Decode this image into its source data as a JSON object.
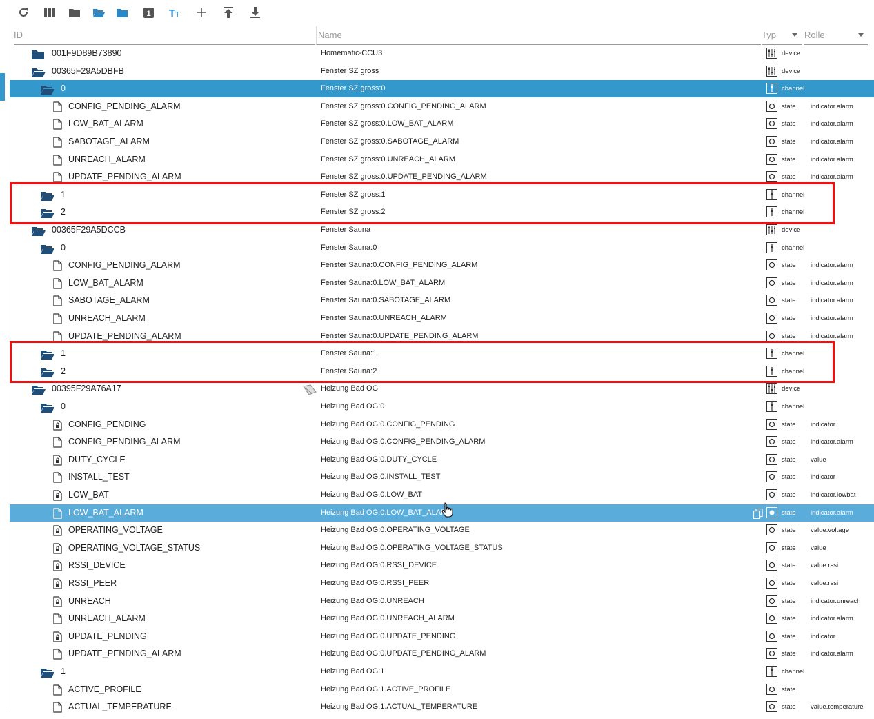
{
  "colors": {
    "accent": "#3399cc",
    "folder": "#1f4e78",
    "highlight_box": "#ee1111"
  },
  "toolbar": [
    {
      "icon": "refresh-icon"
    },
    {
      "icon": "columns-icon"
    },
    {
      "icon": "folder-closed-icon"
    },
    {
      "icon": "folder-open-icon"
    },
    {
      "icon": "folder-filled-icon"
    },
    {
      "icon": "counter-icon",
      "label": "1"
    },
    {
      "icon": "text-size-icon"
    },
    {
      "icon": "plus-icon"
    },
    {
      "icon": "upload-icon"
    },
    {
      "icon": "download-icon"
    }
  ],
  "header": {
    "id": "ID",
    "name": "Name",
    "typ": "Typ",
    "rolle": "Rolle"
  },
  "rows": [
    {
      "id": "001F9D89B73890",
      "name": "Homematic-CCU3",
      "type": "device",
      "role": "",
      "level": 0,
      "icon": "folder",
      "state": ""
    },
    {
      "id": "00365F29A5DBFB",
      "name": "Fenster SZ gross",
      "type": "device",
      "role": "",
      "level": 0,
      "icon": "folder-open",
      "state": ""
    },
    {
      "id": "0",
      "name": "Fenster SZ gross:0",
      "type": "channel",
      "role": "",
      "level": 1,
      "icon": "folder-open",
      "state": "sel"
    },
    {
      "id": "CONFIG_PENDING_ALARM",
      "name": "Fenster SZ gross:0.CONFIG_PENDING_ALARM",
      "type": "state",
      "role": "indicator.alarm",
      "level": 2,
      "icon": "file",
      "state": ""
    },
    {
      "id": "LOW_BAT_ALARM",
      "name": "Fenster SZ gross:0.LOW_BAT_ALARM",
      "type": "state",
      "role": "indicator.alarm",
      "level": 2,
      "icon": "file",
      "state": ""
    },
    {
      "id": "SABOTAGE_ALARM",
      "name": "Fenster SZ gross:0.SABOTAGE_ALARM",
      "type": "state",
      "role": "indicator.alarm",
      "level": 2,
      "icon": "file",
      "state": ""
    },
    {
      "id": "UNREACH_ALARM",
      "name": "Fenster SZ gross:0.UNREACH_ALARM",
      "type": "state",
      "role": "indicator.alarm",
      "level": 2,
      "icon": "file",
      "state": ""
    },
    {
      "id": "UPDATE_PENDING_ALARM",
      "name": "Fenster SZ gross:0.UPDATE_PENDING_ALARM",
      "type": "state",
      "role": "indicator.alarm",
      "level": 2,
      "icon": "file",
      "state": ""
    },
    {
      "id": "1",
      "name": "Fenster SZ gross:1",
      "type": "channel",
      "role": "",
      "level": 1,
      "icon": "folder-open",
      "state": ""
    },
    {
      "id": "2",
      "name": "Fenster SZ gross:2",
      "type": "channel",
      "role": "",
      "level": 1,
      "icon": "folder-open",
      "state": ""
    },
    {
      "id": "00365F29A5DCCB",
      "name": "Fenster Sauna",
      "type": "device",
      "role": "",
      "level": 0,
      "icon": "folder-open",
      "state": ""
    },
    {
      "id": "0",
      "name": "Fenster Sauna:0",
      "type": "channel",
      "role": "",
      "level": 1,
      "icon": "folder-open",
      "state": ""
    },
    {
      "id": "CONFIG_PENDING_ALARM",
      "name": "Fenster Sauna:0.CONFIG_PENDING_ALARM",
      "type": "state",
      "role": "indicator.alarm",
      "level": 2,
      "icon": "file",
      "state": ""
    },
    {
      "id": "LOW_BAT_ALARM",
      "name": "Fenster Sauna:0.LOW_BAT_ALARM",
      "type": "state",
      "role": "indicator.alarm",
      "level": 2,
      "icon": "file",
      "state": ""
    },
    {
      "id": "SABOTAGE_ALARM",
      "name": "Fenster Sauna:0.SABOTAGE_ALARM",
      "type": "state",
      "role": "indicator.alarm",
      "level": 2,
      "icon": "file",
      "state": ""
    },
    {
      "id": "UNREACH_ALARM",
      "name": "Fenster Sauna:0.UNREACH_ALARM",
      "type": "state",
      "role": "indicator.alarm",
      "level": 2,
      "icon": "file",
      "state": ""
    },
    {
      "id": "UPDATE_PENDING_ALARM",
      "name": "Fenster Sauna:0.UPDATE_PENDING_ALARM",
      "type": "state",
      "role": "indicator.alarm",
      "level": 2,
      "icon": "file",
      "state": ""
    },
    {
      "id": "1",
      "name": "Fenster Sauna:1",
      "type": "channel",
      "role": "",
      "level": 1,
      "icon": "folder-open",
      "state": ""
    },
    {
      "id": "2",
      "name": "Fenster Sauna:2",
      "type": "channel",
      "role": "",
      "level": 1,
      "icon": "folder-open",
      "state": ""
    },
    {
      "id": "00395F29A76A17",
      "name": "Heizung Bad OG",
      "type": "device",
      "role": "",
      "level": 0,
      "icon": "folder-open",
      "state": ""
    },
    {
      "id": "0",
      "name": "Heizung Bad OG:0",
      "type": "channel",
      "role": "",
      "level": 1,
      "icon": "folder-open",
      "state": ""
    },
    {
      "id": "CONFIG_PENDING",
      "name": "Heizung Bad OG:0.CONFIG_PENDING",
      "type": "state",
      "role": "indicator",
      "level": 2,
      "icon": "file-lock",
      "state": ""
    },
    {
      "id": "CONFIG_PENDING_ALARM",
      "name": "Heizung Bad OG:0.CONFIG_PENDING_ALARM",
      "type": "state",
      "role": "indicator.alarm",
      "level": 2,
      "icon": "file",
      "state": ""
    },
    {
      "id": "DUTY_CYCLE",
      "name": "Heizung Bad OG:0.DUTY_CYCLE",
      "type": "state",
      "role": "value",
      "level": 2,
      "icon": "file-lock",
      "state": ""
    },
    {
      "id": "INSTALL_TEST",
      "name": "Heizung Bad OG:0.INSTALL_TEST",
      "type": "state",
      "role": "indicator",
      "level": 2,
      "icon": "file",
      "state": ""
    },
    {
      "id": "LOW_BAT",
      "name": "Heizung Bad OG:0.LOW_BAT",
      "type": "state",
      "role": "indicator.lowbat",
      "level": 2,
      "icon": "file-lock",
      "state": ""
    },
    {
      "id": "LOW_BAT_ALARM",
      "name": "Heizung Bad OG:0.LOW_BAT_ALARM",
      "type": "state",
      "role": "indicator.alarm",
      "level": 2,
      "icon": "file",
      "state": "hl"
    },
    {
      "id": "OPERATING_VOLTAGE",
      "name": "Heizung Bad OG:0.OPERATING_VOLTAGE",
      "type": "state",
      "role": "value.voltage",
      "level": 2,
      "icon": "file-lock",
      "state": ""
    },
    {
      "id": "OPERATING_VOLTAGE_STATUS",
      "name": "Heizung Bad OG:0.OPERATING_VOLTAGE_STATUS",
      "type": "state",
      "role": "value",
      "level": 2,
      "icon": "file-lock",
      "state": ""
    },
    {
      "id": "RSSI_DEVICE",
      "name": "Heizung Bad OG:0.RSSI_DEVICE",
      "type": "state",
      "role": "value.rssi",
      "level": 2,
      "icon": "file-lock",
      "state": ""
    },
    {
      "id": "RSSI_PEER",
      "name": "Heizung Bad OG:0.RSSI_PEER",
      "type": "state",
      "role": "value.rssi",
      "level": 2,
      "icon": "file-lock",
      "state": ""
    },
    {
      "id": "UNREACH",
      "name": "Heizung Bad OG:0.UNREACH",
      "type": "state",
      "role": "indicator.unreach",
      "level": 2,
      "icon": "file-lock",
      "state": ""
    },
    {
      "id": "UNREACH_ALARM",
      "name": "Heizung Bad OG:0.UNREACH_ALARM",
      "type": "state",
      "role": "indicator.alarm",
      "level": 2,
      "icon": "file",
      "state": ""
    },
    {
      "id": "UPDATE_PENDING",
      "name": "Heizung Bad OG:0.UPDATE_PENDING",
      "type": "state",
      "role": "indicator",
      "level": 2,
      "icon": "file-lock",
      "state": ""
    },
    {
      "id": "UPDATE_PENDING_ALARM",
      "name": "Heizung Bad OG:0.UPDATE_PENDING_ALARM",
      "type": "state",
      "role": "indicator.alarm",
      "level": 2,
      "icon": "file",
      "state": ""
    },
    {
      "id": "1",
      "name": "Heizung Bad OG:1",
      "type": "channel",
      "role": "",
      "level": 1,
      "icon": "folder-open",
      "state": ""
    },
    {
      "id": "ACTIVE_PROFILE",
      "name": "Heizung Bad OG:1.ACTIVE_PROFILE",
      "type": "state",
      "role": "",
      "level": 2,
      "icon": "file",
      "state": ""
    },
    {
      "id": "ACTUAL_TEMPERATURE",
      "name": "Heizung Bad OG:1.ACTUAL_TEMPERATURE",
      "type": "state",
      "role": "value.temperature",
      "level": 2,
      "icon": "file",
      "state": ""
    }
  ],
  "highlight_groups": [
    {
      "rows": [
        8,
        9
      ]
    },
    {
      "rows": [
        17,
        18
      ]
    }
  ]
}
